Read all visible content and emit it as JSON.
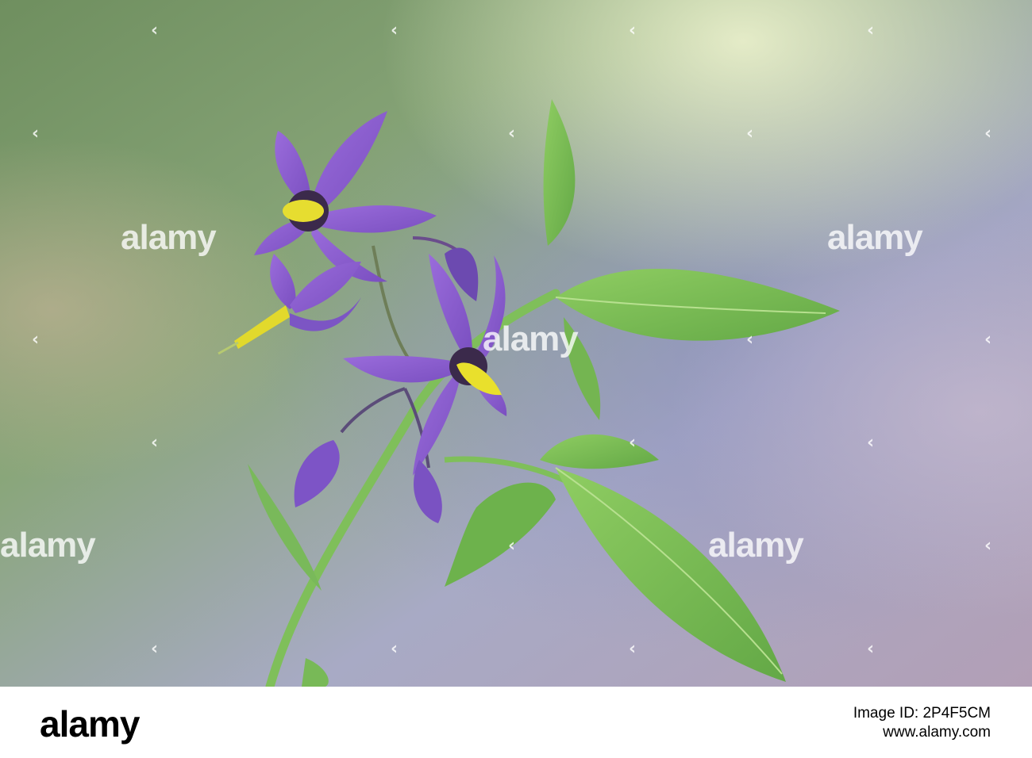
{
  "photo": {
    "subject": "purple-flower-sprig",
    "colors": {
      "petal": "#8a5fd0",
      "anther": "#e9e02c",
      "leaf": "#78bd55",
      "bg_green": "#7e9a6a",
      "bg_violet": "#a09bc2"
    }
  },
  "watermark": {
    "text": "alamy"
  },
  "footer": {
    "logo": "alamy",
    "line1": "Image ID: 2P4F5CM",
    "line2": "www.alamy.com"
  }
}
